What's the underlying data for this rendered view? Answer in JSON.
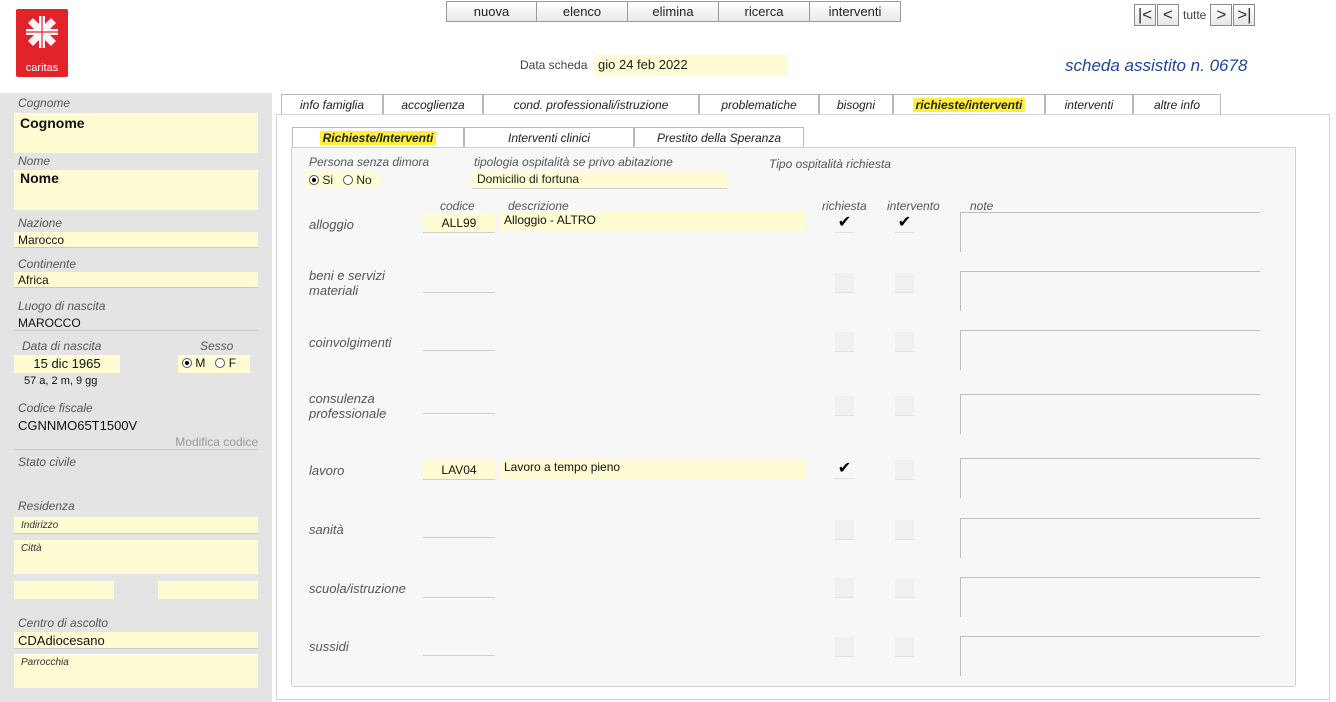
{
  "logo": {
    "text": "caritas"
  },
  "toolbar": {
    "buttons": [
      "nuova",
      "elenco",
      "elimina",
      "ricerca",
      "interventi"
    ]
  },
  "nav": {
    "first": "|<",
    "prev": "<",
    "label": "tutte",
    "next": ">",
    "last": ">|"
  },
  "header": {
    "data_scheda_label": "Data scheda",
    "data_scheda_value": "gio 24 feb 2022",
    "title": "scheda assistito n.  0678"
  },
  "person": {
    "cognome_label": "Cognome",
    "cognome_value": "Cognome",
    "nome_label": "Nome",
    "nome_value": "Nome",
    "nazione_label": "Nazione",
    "nazione_value": "Marocco",
    "continente_label": "Continente",
    "continente_value": "Africa",
    "luogo_label": "Luogo di nascita",
    "luogo_value": "MAROCCO",
    "data_nascita_label": "Data di nascita",
    "data_nascita_value": "15 dic 1965",
    "eta": "57 a, 2 m, 9 gg",
    "sesso_label": "Sesso",
    "sesso_m": "M",
    "sesso_f": "F",
    "cf_label": "Codice fiscale",
    "cf_value": "CGNNMO65T1500V",
    "modifica_codice": "Modifica codice",
    "stato_civile_label": "Stato civile",
    "residenza_label": "Residenza",
    "indirizzo_label": "Indirizzo",
    "citta_label": "Città",
    "centro_label": "Centro di ascolto",
    "centro_value": "CDAdiocesano",
    "parrocchia_label": "Parrocchia"
  },
  "main_tabs": [
    "info famiglia",
    "accoglienza",
    "cond. professionali/istruzione",
    "problematiche",
    "bisogni",
    "richieste/interventi",
    "interventi",
    "altre info"
  ],
  "sub_tabs": [
    "Richieste/Interventi",
    "Interventi clinici",
    "Prestito della Speranza"
  ],
  "form": {
    "senza_dimora_label": "Persona senza dimora",
    "si": "Si",
    "no": "No",
    "tipologia_label": "tipologia ospitalità se privo abitazione",
    "tipologia_value": "Domicilio di fortuna",
    "tipo_richiesta_label": "Tipo ospitalità richiesta",
    "col_codice": "codice",
    "col_descrizione": "descrizione",
    "col_richiesta": "richiesta",
    "col_intervento": "intervento",
    "col_note": "note"
  },
  "rows": [
    {
      "label": "alloggio",
      "codice": "ALL99",
      "descrizione": "Alloggio - ALTRO",
      "richiesta": "✔",
      "intervento": "✔"
    },
    {
      "label": "beni e servizi materiali",
      "codice": "",
      "descrizione": "",
      "richiesta": "",
      "intervento": ""
    },
    {
      "label": "coinvolgimenti",
      "codice": "",
      "descrizione": "",
      "richiesta": "",
      "intervento": ""
    },
    {
      "label": "consulenza professionale",
      "codice": "",
      "descrizione": "",
      "richiesta": "",
      "intervento": ""
    },
    {
      "label": "lavoro",
      "codice": "LAV04",
      "descrizione": "Lavoro a tempo pieno",
      "richiesta": "✔",
      "intervento": ""
    },
    {
      "label": "sanità",
      "codice": "",
      "descrizione": "",
      "richiesta": "",
      "intervento": ""
    },
    {
      "label": "scuola/istruzione",
      "codice": "",
      "descrizione": "",
      "richiesta": "",
      "intervento": ""
    },
    {
      "label": "sussidi",
      "codice": "",
      "descrizione": "",
      "richiesta": "",
      "intervento": ""
    }
  ],
  "colors": {
    "field_bg": "#fffbd2",
    "active_tab": "#ffef3a",
    "logo_red": "#e2232a",
    "title_blue": "#1e46a0"
  }
}
